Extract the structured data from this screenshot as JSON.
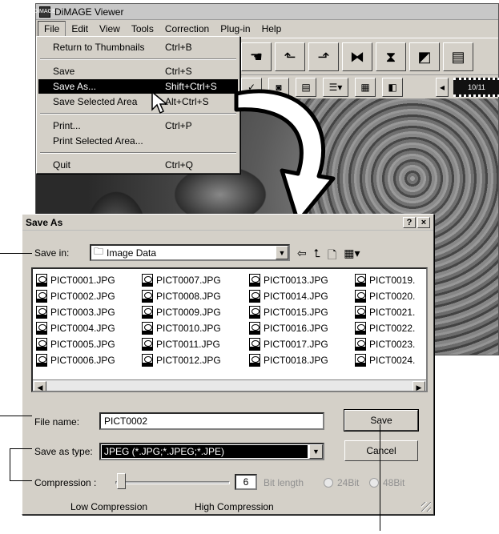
{
  "app": {
    "title": "DiMAGE Viewer",
    "icon_text": "DiMAGE",
    "menus": [
      "File",
      "Edit",
      "View",
      "Tools",
      "Correction",
      "Plug-in",
      "Help"
    ],
    "filmstrip_text": "10/11"
  },
  "file_menu": {
    "items": [
      {
        "label": "Return to Thumbnails",
        "shortcut": "Ctrl+B"
      },
      {
        "label": "Save",
        "shortcut": "Ctrl+S"
      },
      {
        "label": "Save As...",
        "shortcut": "Shift+Ctrl+S",
        "highlighted": true
      },
      {
        "label": "Save Selected Area",
        "shortcut": "Alt+Ctrl+S"
      },
      {
        "label": "Print...",
        "shortcut": "Ctrl+P"
      },
      {
        "label": "Print Selected Area...",
        "shortcut": ""
      },
      {
        "label": "Quit",
        "shortcut": "Ctrl+Q"
      }
    ]
  },
  "dialog": {
    "title": "Save As",
    "help_btn": "?",
    "close_btn": "×",
    "save_in_label": "Save in:",
    "save_in_value": "Image Data",
    "files": [
      [
        "PICT0001.JPG",
        "PICT0002.JPG",
        "PICT0003.JPG",
        "PICT0004.JPG",
        "PICT0005.JPG",
        "PICT0006.JPG"
      ],
      [
        "PICT0007.JPG",
        "PICT0008.JPG",
        "PICT0009.JPG",
        "PICT0010.JPG",
        "PICT0011.JPG",
        "PICT0012.JPG"
      ],
      [
        "PICT0013.JPG",
        "PICT0014.JPG",
        "PICT0015.JPG",
        "PICT0016.JPG",
        "PICT0017.JPG",
        "PICT0018.JPG"
      ],
      [
        "PICT0019.",
        "PICT0020.",
        "PICT0021.",
        "PICT0022.",
        "PICT0023.",
        "PICT0024."
      ]
    ],
    "file_name_label": "File name:",
    "file_name_value": "PICT0002",
    "save_type_label": "Save as type:",
    "save_type_value": "JPEG (*.JPG;*.JPEG;*.JPE)",
    "save_button": "Save",
    "cancel_button": "Cancel",
    "compression_label": "Compression :",
    "compression_value": "6",
    "bit_length_label": "Bit length",
    "bit24_label": "24Bit",
    "bit48_label": "48Bit",
    "low_compression": "Low Compression",
    "high_compression": "High Compression"
  }
}
